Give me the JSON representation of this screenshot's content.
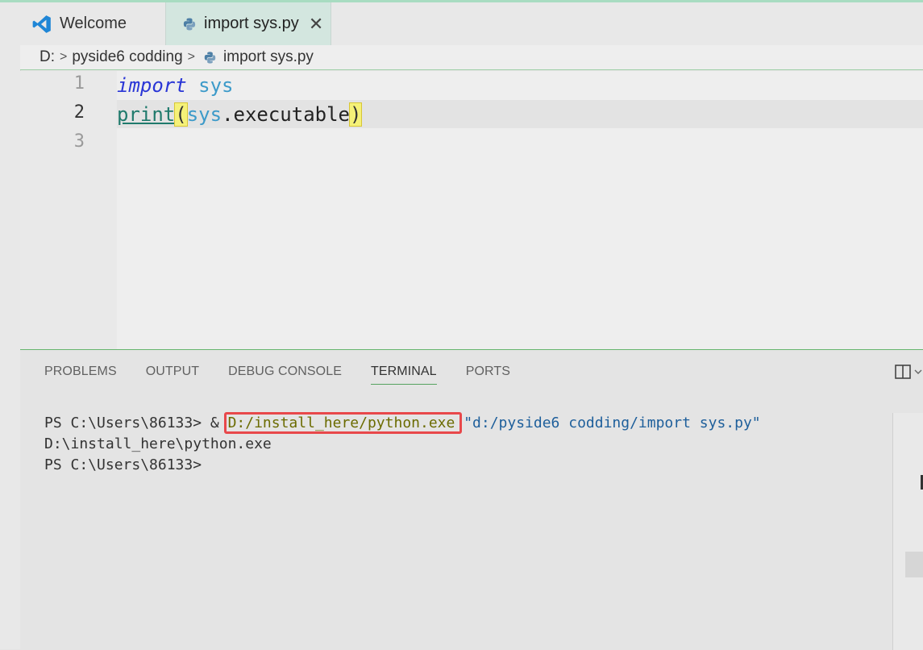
{
  "tabs": [
    {
      "label": "Welcome",
      "icon": "vscode-logo-icon",
      "active": false
    },
    {
      "label": "import sys.py",
      "icon": "python-file-icon",
      "active": true,
      "close": "✕"
    }
  ],
  "breadcrumb": {
    "items": [
      "D:",
      "pyside6 codding",
      "import sys.py"
    ],
    "separator": ">"
  },
  "editor": {
    "line_numbers": [
      "1",
      "2",
      "3"
    ],
    "current_line": "2",
    "lines": [
      {
        "tokens": [
          "import",
          " ",
          "sys"
        ]
      },
      {
        "tokens": [
          "print",
          "(",
          "sys",
          ".executable",
          ")"
        ]
      },
      {
        "tokens": []
      }
    ]
  },
  "panel": {
    "tabs": [
      "PROBLEMS",
      "OUTPUT",
      "DEBUG CONSOLE",
      "TERMINAL",
      "PORTS"
    ],
    "active_tab": "TERMINAL"
  },
  "terminal": {
    "line1_prompt": "PS C:\\Users\\86133> & ",
    "line1_path": "D:/install_here/python.exe",
    "line1_arg": "\"d:/pyside6 codding/import sys.py\"",
    "line2": "D:\\install_here\\python.exe",
    "line3": "PS C:\\Users\\86133>"
  },
  "colors": {
    "accent_green": "#66b66e",
    "highlight_red": "#e8484b",
    "keyword": "#2a36d6",
    "module": "#3c9ac9",
    "function": "#1f7a6c"
  }
}
